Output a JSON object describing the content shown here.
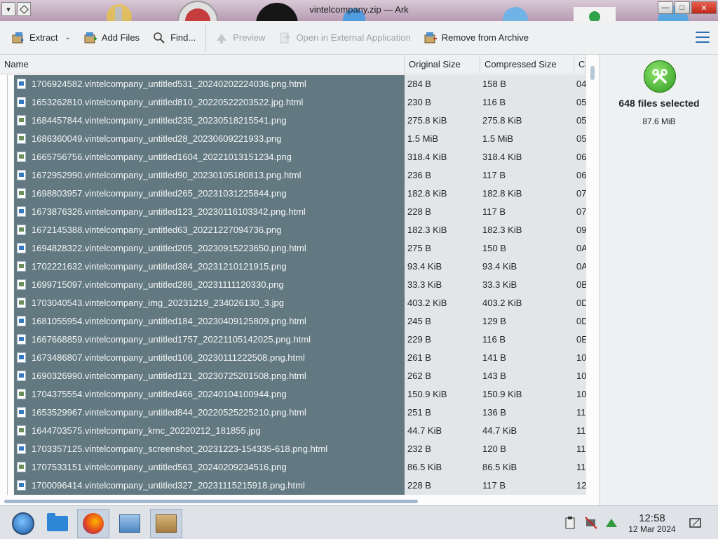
{
  "window": {
    "title": "vintelcompany.zip — Ark"
  },
  "toolbar": {
    "extract_label": "Extract",
    "add_files_label": "Add Files",
    "find_label": "Find...",
    "preview_label": "Preview",
    "open_external_label": "Open in External Application",
    "remove_label": "Remove from Archive"
  },
  "columns": {
    "name": "Name",
    "original_size": "Original Size",
    "compressed_size": "Compressed Size",
    "crc": "C"
  },
  "rows": [
    {
      "name": "1706924582.vintelcompany_untitled531_20240202224036.png.html",
      "orig": "284 B",
      "comp": "158 B",
      "crc": "04",
      "type": "html"
    },
    {
      "name": "1653262810.vintelcompany_untitled810_20220522203522.jpg.html",
      "orig": "230 B",
      "comp": "116 B",
      "crc": "05",
      "type": "html"
    },
    {
      "name": "1684457844.vintelcompany_untitled235_20230518215541.png",
      "orig": "275.8 KiB",
      "comp": "275.8 KiB",
      "crc": "05",
      "type": "img"
    },
    {
      "name": "1686360049.vintelcompany_untitled28_20230609221933.png",
      "orig": "1.5 MiB",
      "comp": "1.5 MiB",
      "crc": "05",
      "type": "img"
    },
    {
      "name": "1665756756.vintelcompany_untitled1604_20221013151234.png",
      "orig": "318.4 KiB",
      "comp": "318.4 KiB",
      "crc": "06",
      "type": "img"
    },
    {
      "name": "1672952990.vintelcompany_untitled90_20230105180813.png.html",
      "orig": "236 B",
      "comp": "117 B",
      "crc": "06",
      "type": "html"
    },
    {
      "name": "1698803957.vintelcompany_untitled265_20231031225844.png",
      "orig": "182.8 KiB",
      "comp": "182.8 KiB",
      "crc": "07",
      "type": "img"
    },
    {
      "name": "1673876326.vintelcompany_untitled123_20230116103342.png.html",
      "orig": "228 B",
      "comp": "117 B",
      "crc": "07",
      "type": "html"
    },
    {
      "name": "1672145388.vintelcompany_untitled63_20221227094736.png",
      "orig": "182.3 KiB",
      "comp": "182.3 KiB",
      "crc": "09",
      "type": "img"
    },
    {
      "name": "1694828322.vintelcompany_untitled205_20230915223650.png.html",
      "orig": "275 B",
      "comp": "150 B",
      "crc": "0A",
      "type": "html"
    },
    {
      "name": "1702221632.vintelcompany_untitled384_20231210121915.png",
      "orig": "93.4 KiB",
      "comp": "93.4 KiB",
      "crc": "0A",
      "type": "img"
    },
    {
      "name": "1699715097.vintelcompany_untitled286_20231111120330.png",
      "orig": "33.3 KiB",
      "comp": "33.3 KiB",
      "crc": "0B",
      "type": "img"
    },
    {
      "name": "1703040543.vintelcompany_img_20231219_234026130_3.jpg",
      "orig": "403.2 KiB",
      "comp": "403.2 KiB",
      "crc": "0D",
      "type": "img"
    },
    {
      "name": "1681055954.vintelcompany_untitled184_20230409125809.png.html",
      "orig": "245 B",
      "comp": "129 B",
      "crc": "0D",
      "type": "html"
    },
    {
      "name": "1667668859.vintelcompany_untitled1757_20221105142025.png.html",
      "orig": "229 B",
      "comp": "116 B",
      "crc": "0E",
      "type": "html"
    },
    {
      "name": "1673486807.vintelcompany_untitled106_20230111222508.png.html",
      "orig": "261 B",
      "comp": "141 B",
      "crc": "10",
      "type": "html"
    },
    {
      "name": "1690326990.vintelcompany_untitled121_20230725201508.png.html",
      "orig": "262 B",
      "comp": "143 B",
      "crc": "10",
      "type": "html"
    },
    {
      "name": "1704375554.vintelcompany_untitled466_20240104100944.png",
      "orig": "150.9 KiB",
      "comp": "150.9 KiB",
      "crc": "10",
      "type": "img"
    },
    {
      "name": "1653529967.vintelcompany_untitled844_20220525225210.png.html",
      "orig": "251 B",
      "comp": "136 B",
      "crc": "11",
      "type": "html"
    },
    {
      "name": "1644703575.vintelcompany_kmc_20220212_181855.jpg",
      "orig": "44.7 KiB",
      "comp": "44.7 KiB",
      "crc": "11",
      "type": "img"
    },
    {
      "name": "1703357125.vintelcompany_screenshot_20231223-154335-618.png.html",
      "orig": "232 B",
      "comp": "120 B",
      "crc": "11",
      "type": "html"
    },
    {
      "name": "1707533151.vintelcompany_untitled563_20240209234516.png",
      "orig": "86.5 KiB",
      "comp": "86.5 KiB",
      "crc": "11",
      "type": "img"
    },
    {
      "name": "1700096414.vintelcompany_untitled327_20231115215918.png.html",
      "orig": "228 B",
      "comp": "117 B",
      "crc": "12",
      "type": "html"
    }
  ],
  "info_panel": {
    "selected_count": "648 files selected",
    "selected_size": "87.6 MiB",
    "icon": "tools-icon"
  },
  "taskbar": {
    "time": "12:58",
    "date": "12 Mar 2024"
  },
  "colors": {
    "selection": "#627981",
    "accent": "#2b6fb5",
    "titlebar": "#b69bb3"
  }
}
